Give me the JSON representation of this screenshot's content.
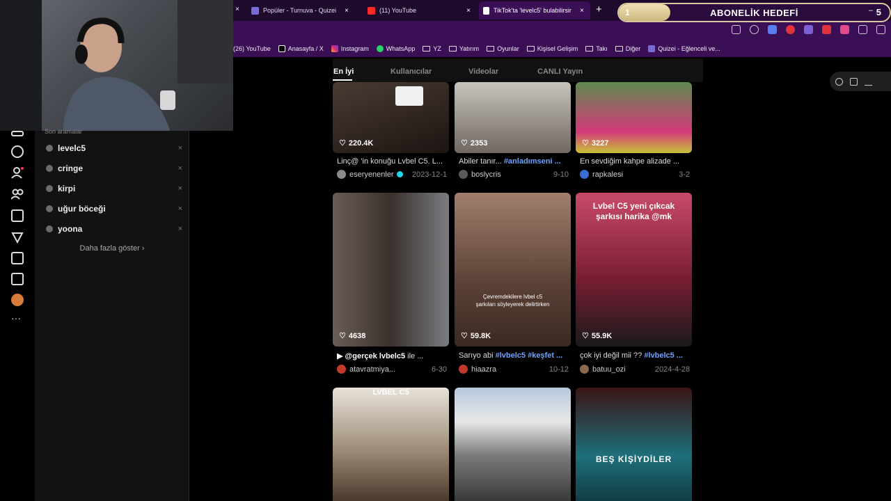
{
  "browser": {
    "tabs": [
      {
        "label": "Popüler - Turnuva - Quizei",
        "active": false
      },
      {
        "label": "(11) YouTube",
        "active": false
      },
      {
        "label": "TikTok'ta 'levelc5' bulabilirsiniz",
        "active": true
      }
    ],
    "new_tab": "+",
    "close_glyph": "×",
    "bookmarks": [
      {
        "label": "(26) YouTube",
        "icon": "youtube-icon"
      },
      {
        "label": "Anasayfa / X",
        "icon": "x-icon"
      },
      {
        "label": "Instagram",
        "icon": "instagram-icon"
      },
      {
        "label": "WhatsApp",
        "icon": "whatsapp-icon"
      },
      {
        "label": "YZ",
        "icon": "folder-icon"
      },
      {
        "label": "Yatırım",
        "icon": "folder-icon"
      },
      {
        "label": "Oyunlar",
        "icon": "folder-icon"
      },
      {
        "label": "Kişisel Gelişim",
        "icon": "folder-icon"
      },
      {
        "label": "Takı",
        "icon": "folder-icon"
      },
      {
        "label": "Diğer",
        "icon": "folder-icon"
      },
      {
        "label": "Quizei - Eğlenceli ve...",
        "icon": "quizei-icon"
      }
    ]
  },
  "goal_overlay": {
    "title": "ABONELİK HEDEFİ",
    "start": "1",
    "end": "5",
    "progress": 0.19,
    "dash": "–"
  },
  "search_history": {
    "heading": "Son aramalar",
    "items": [
      "levelc5",
      "cringe",
      "kirpi",
      "uğur böceği",
      "yoona"
    ],
    "remove_glyph": "×",
    "more_label": "Daha fazla göster ›"
  },
  "results_tabs": [
    {
      "label": "En İyi",
      "active": true
    },
    {
      "label": "Kullanıcılar",
      "active": false
    },
    {
      "label": "Videolar",
      "active": false
    },
    {
      "label": "CANLI Yayın",
      "active": false
    }
  ],
  "videos": [
    {
      "likes": "220.4K",
      "caption": "Linç@ 'in konuğu Lvbel C5. L...",
      "tags": "",
      "author": "eseryenenler",
      "date": "2023-12-1",
      "verified": true,
      "overlay": ""
    },
    {
      "likes": "2353",
      "caption": "Abiler tanır... ",
      "tags": "#anladımseni ...",
      "author": "boslycris",
      "date": "9-10",
      "verified": false,
      "overlay": ""
    },
    {
      "likes": "3227",
      "caption": "En sevdiğim kahpe alizade ...",
      "tags": "",
      "author": "rapkalesi",
      "date": "3-2",
      "verified": false,
      "overlay": ""
    },
    {
      "likes": "4638",
      "caption": "▶ @gerçek lvbelc5",
      "tags": "  ile ...",
      "author": "atavratmiya...",
      "date": "6-30",
      "verified": false,
      "overlay": ""
    },
    {
      "likes": "59.8K",
      "caption": "Sarıyo abi ",
      "tags": "#lvbelc5 #keşfet ...",
      "author": "hiaazra",
      "date": "10-12",
      "verified": false,
      "overlay": "Çevremdekilere lvbel c5 şarkıları söyleyerek delirtirken"
    },
    {
      "likes": "55.9K",
      "caption": "çok iyi değil mii ?? ",
      "tags": "#lvbelc5 ...",
      "author": "batuu_ozi",
      "date": "2024-4-28",
      "verified": false,
      "overlay": "Lvbel C5 yeni çıkcak şarkısı harika @mk"
    },
    {
      "likes": "",
      "caption": "",
      "tags": "",
      "author": "",
      "date": "",
      "verified": false,
      "overlay": "LVBEL C5"
    },
    {
      "likes": "",
      "caption": "",
      "tags": "",
      "author": "",
      "date": "",
      "verified": false,
      "overlay": ""
    },
    {
      "likes": "",
      "caption": "",
      "tags": "",
      "author": "",
      "date": "",
      "verified": false,
      "overlay": "BEŞ KİŞİYDİLER"
    }
  ],
  "colors": {
    "browser_bg": "#3a0f56",
    "tabbar_bg": "#1f0a2e",
    "hashtag": "#6fa3ff",
    "verified": "#20d5ec"
  }
}
